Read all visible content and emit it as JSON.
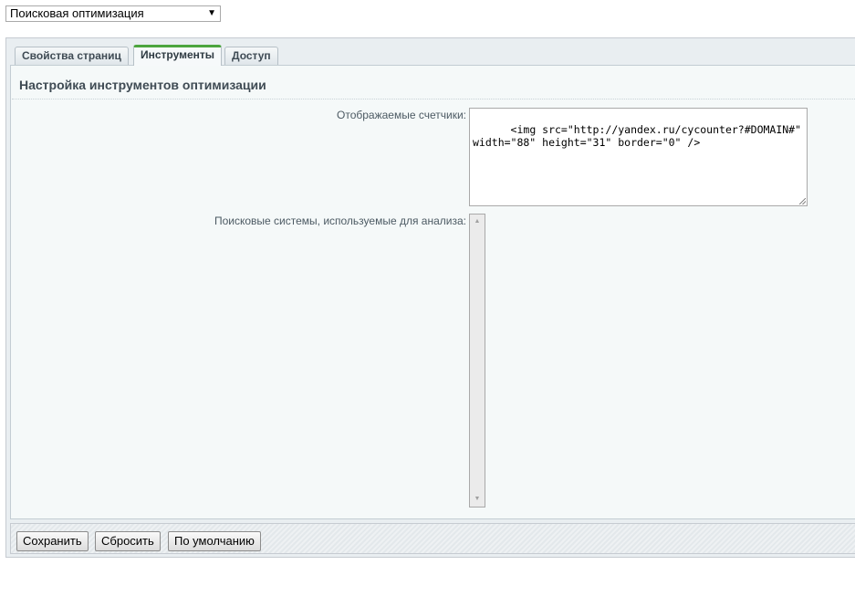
{
  "module_select": {
    "value": "Поисковая оптимизация"
  },
  "tabs": [
    {
      "label": "Свойства страниц"
    },
    {
      "label": "Инструменты",
      "active": true
    },
    {
      "label": "Доступ"
    }
  ],
  "section": {
    "title": "Настройка инструментов оптимизации"
  },
  "fields": {
    "counters": {
      "label": "Отображаемые счетчики:",
      "value": "<img src=\"http://yandex.ru/cycounter?#DOMAIN#\" width=\"88\" height=\"31\" border=\"0\" />"
    },
    "search_engines": {
      "label": "Поисковые системы, используемые для анализа:"
    }
  },
  "buttons": {
    "save": "Сохранить",
    "reset": "Сбросить",
    "default": "По умолчанию"
  },
  "colors": {
    "active_tab_accent": "#4ca53e",
    "frame_background": "#e9eef1",
    "content_background": "#f5f9f9"
  }
}
